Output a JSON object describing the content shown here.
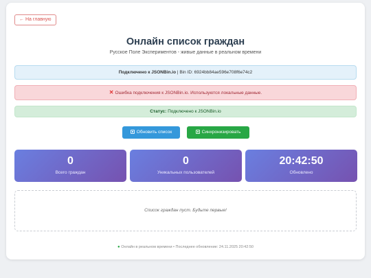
{
  "nav": {
    "back_label": "← На главную"
  },
  "header": {
    "title": "Онлайн список граждан",
    "subtitle": "Русское Поле Экспериментов - живые данные в реальном времени"
  },
  "connection": {
    "label": "Подключено к JSONBin.io",
    "separator": " | ",
    "bin_text": "Bin ID: 6924bb84ae596e708f6e74c2"
  },
  "error": {
    "text": "Ошибка подключения к JSONBin.io. Используются локальные данные.",
    "icon": "cross-mark-icon"
  },
  "status": {
    "label": "Статус:",
    "text": " Подключено к JSONBin.io"
  },
  "actions": {
    "refresh_label": "Обновить список",
    "sync_label": "Синхронизировать",
    "icon": "refresh-icon"
  },
  "stats": [
    {
      "value": "0",
      "label": "Всего граждан"
    },
    {
      "value": "0",
      "label": "Уникальных пользователей"
    },
    {
      "value": "20:42:50",
      "label": "Обновлено"
    }
  ],
  "list": {
    "empty_text": "Список граждан пуст. Будьте первые!"
  },
  "footer": {
    "dot": "●",
    "text": " Онлайн в реальном времени • Последнее обновление: 24.11.2025 20:42:50"
  },
  "colors": {
    "accent_blue": "#3498db",
    "accent_green": "#28a745",
    "error_red": "#d9534f",
    "stat_gradient_start": "#6a7fe0",
    "stat_gradient_end": "#7652b0"
  }
}
